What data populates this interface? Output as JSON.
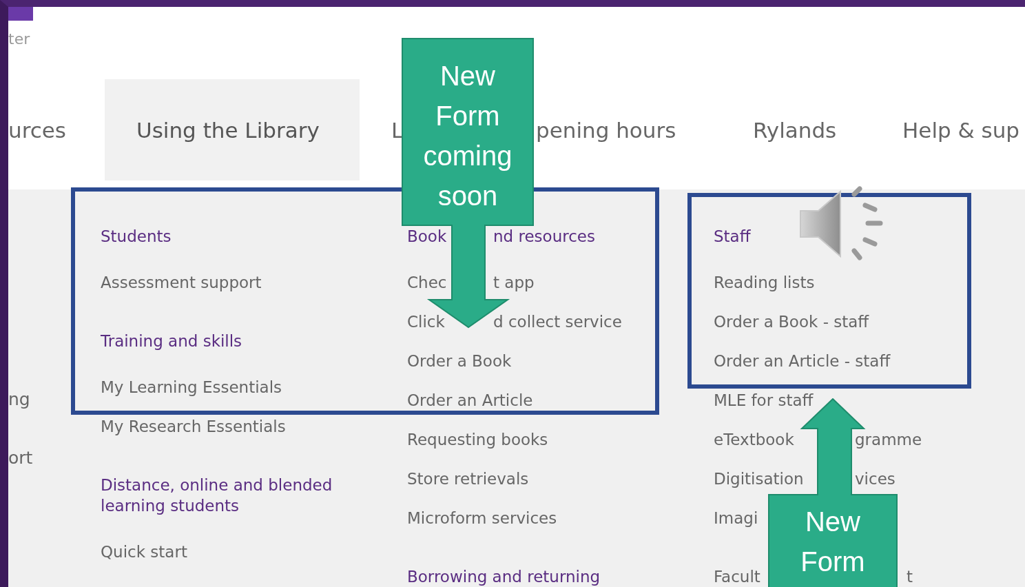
{
  "header": {
    "cut_text": "ter"
  },
  "nav": [
    {
      "label": "urces",
      "selected": false
    },
    {
      "label": "Using the Library",
      "selected": true
    },
    {
      "label": "L",
      "selected": false
    },
    {
      "label": "pening hours",
      "selected": false
    },
    {
      "label": "Rylands",
      "selected": false
    },
    {
      "label": "Help & sup",
      "selected": false
    }
  ],
  "menu": {
    "columns": [
      {
        "items": [
          {
            "kind": "link",
            "text": "ng"
          },
          {
            "kind": "spaced",
            "text": "ort"
          }
        ]
      },
      {
        "items": [
          {
            "kind": "heading",
            "text": "Students"
          },
          {
            "kind": "link",
            "text": "Assessment support"
          },
          {
            "kind": "heading",
            "text": "Training and skills"
          },
          {
            "kind": "link",
            "text": "My Learning Essentials"
          },
          {
            "kind": "link",
            "text": "My Research Essentials"
          },
          {
            "kind": "heading",
            "text": "Distance, online and blended learning students"
          },
          {
            "kind": "link",
            "text": "Quick start"
          }
        ]
      },
      {
        "items": [
          {
            "kind": "heading",
            "text": "Book",
            "rest": "nd resources"
          },
          {
            "kind": "link",
            "text": "Chec",
            "rest": "t app"
          },
          {
            "kind": "link",
            "text": "Click",
            "rest": "d collect service"
          },
          {
            "kind": "link",
            "text": "Order a Book"
          },
          {
            "kind": "link",
            "text": "Order an Article"
          },
          {
            "kind": "link",
            "text": "Requesting books"
          },
          {
            "kind": "link",
            "text": "Store retrievals"
          },
          {
            "kind": "link",
            "text": "Microform services"
          },
          {
            "kind": "heading",
            "text": "Borrowing and returning"
          }
        ]
      },
      {
        "items": [
          {
            "kind": "heading",
            "text": "Staff"
          },
          {
            "kind": "link",
            "text": "Reading lists"
          },
          {
            "kind": "link",
            "text": "Order a Book - staff"
          },
          {
            "kind": "link",
            "text": "Order an Article - staff"
          },
          {
            "kind": "link",
            "text": "MLE for staff"
          },
          {
            "kind": "link",
            "text": "eTextbook ",
            "rest": "gramme"
          },
          {
            "kind": "link",
            "text": "Digitisation ",
            "rest": "vices"
          },
          {
            "kind": "link",
            "text": "Imagi"
          },
          {
            "kind": "spaced",
            "text": "Facult",
            "rest": "t"
          }
        ]
      }
    ]
  },
  "callouts": [
    {
      "kind": "down",
      "text": "New Form coming soon"
    },
    {
      "kind": "up",
      "text": "New Form"
    }
  ]
}
